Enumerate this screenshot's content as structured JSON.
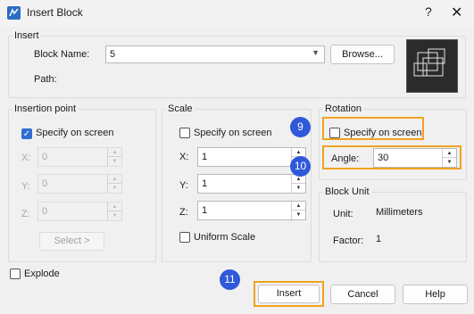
{
  "window": {
    "title": "Insert Block",
    "help_glyph": "?",
    "close_glyph": "✕"
  },
  "insert": {
    "legend": "Insert",
    "block_name_label": "Block Name:",
    "block_name_value": "5",
    "browse_label": "Browse...",
    "path_label": "Path:"
  },
  "insertion_point": {
    "legend": "Insertion point",
    "specify_label": "Specify on screen",
    "specify_checked": true,
    "x_label": "X:",
    "x_value": "0",
    "y_label": "Y:",
    "y_value": "0",
    "z_label": "Z:",
    "z_value": "0",
    "select_label": "Select >"
  },
  "scale": {
    "legend": "Scale",
    "specify_label": "Specify on screen",
    "specify_checked": false,
    "x_label": "X:",
    "x_value": "1",
    "y_label": "Y:",
    "y_value": "1",
    "z_label": "Z:",
    "z_value": "1",
    "uniform_label": "Uniform Scale",
    "uniform_checked": false
  },
  "rotation": {
    "legend": "Rotation",
    "specify_label": "Specify on screen",
    "specify_checked": false,
    "angle_label": "Angle:",
    "angle_value": "30"
  },
  "block_unit": {
    "legend": "Block Unit",
    "unit_label": "Unit:",
    "unit_value": "Millimeters",
    "factor_label": "Factor:",
    "factor_value": "1"
  },
  "explode": {
    "label": "Explode",
    "checked": false
  },
  "buttons": {
    "insert": "Insert",
    "cancel": "Cancel",
    "help": "Help"
  },
  "markers": {
    "m9": "9",
    "m10": "10",
    "m11": "11"
  },
  "colors": {
    "marker": "#2f59d9",
    "highlight": "#f0a320",
    "checkbox": "#2f6fd1"
  }
}
